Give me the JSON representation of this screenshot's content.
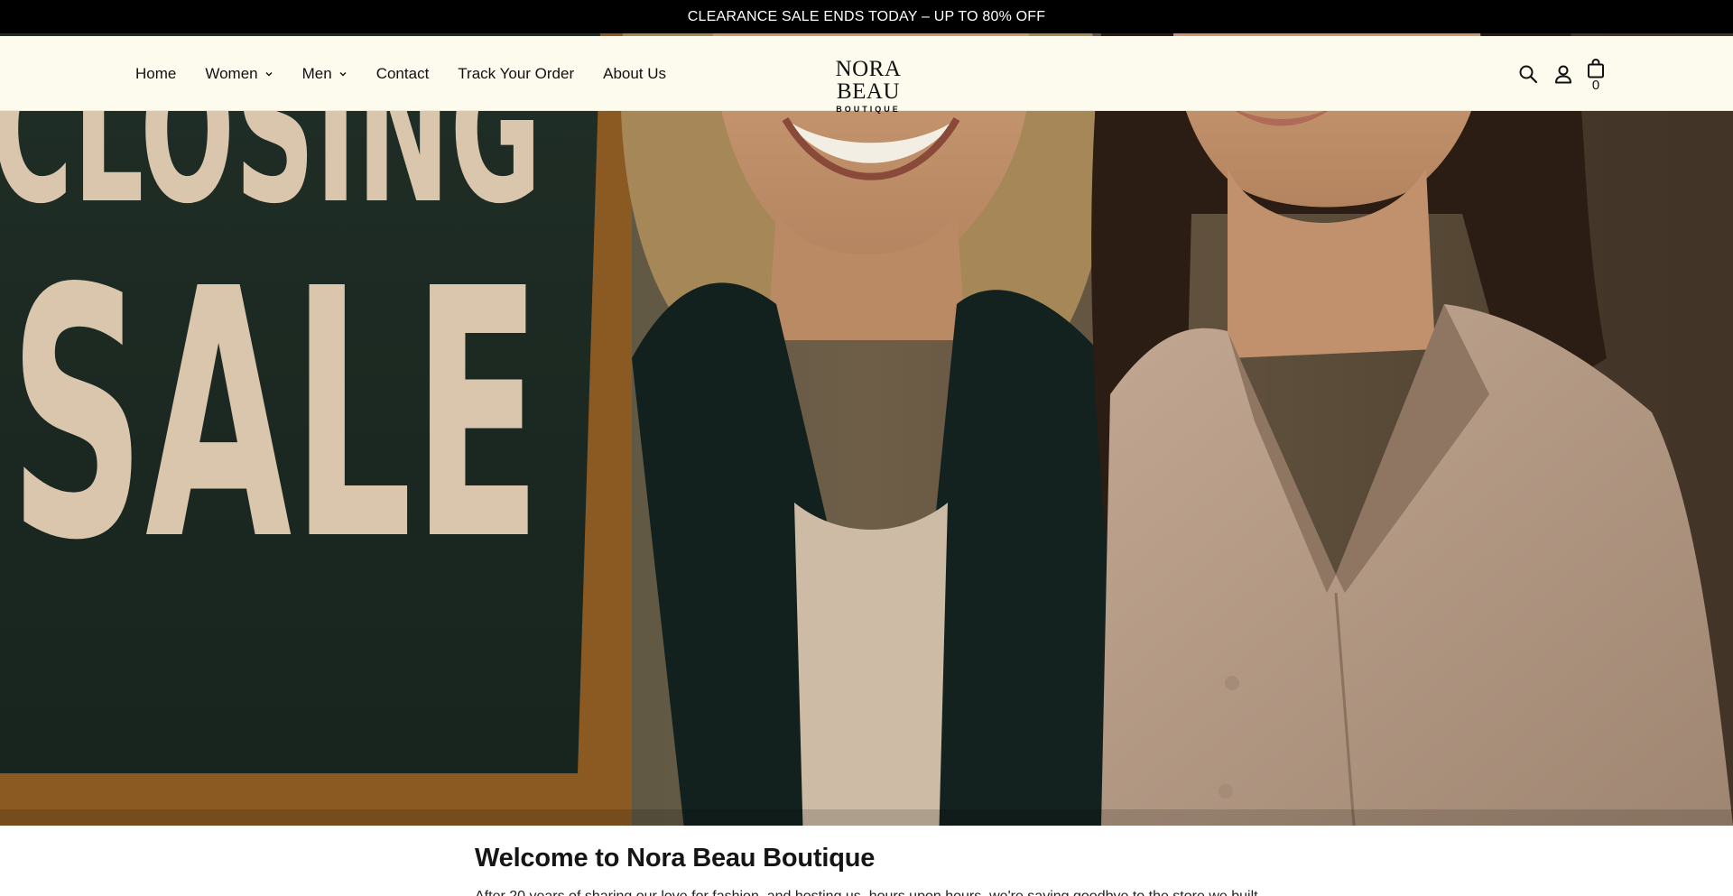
{
  "announcement": {
    "text": "CLEARANCE SALE ENDS TODAY – UP TO 80% OFF"
  },
  "header": {
    "nav": [
      {
        "label": "Home",
        "dropdown": false
      },
      {
        "label": "Women",
        "dropdown": true
      },
      {
        "label": "Men",
        "dropdown": true
      },
      {
        "label": "Contact",
        "dropdown": false
      },
      {
        "label": "Track Your Order",
        "dropdown": false
      },
      {
        "label": "About Us",
        "dropdown": false
      }
    ],
    "logo": {
      "name": "NORA BEAU",
      "tagline": "BOUTIQUE"
    },
    "icons": {
      "search": "search-icon",
      "account": "user-icon",
      "cart": "shopping-bag-icon"
    },
    "cart_count": "0"
  },
  "hero": {
    "sign_text": [
      "CLOSING",
      "SALE"
    ]
  },
  "welcome": {
    "title": "Welcome to Nora Beau Boutique",
    "body": "After 20 years of sharing our love for fashion, and hosting us, hours upon hours, we're saying goodbye to the store we built…"
  },
  "colors": {
    "announcement_bg": "#000000",
    "header_bg": "#fdfaee",
    "text": "#111111"
  }
}
